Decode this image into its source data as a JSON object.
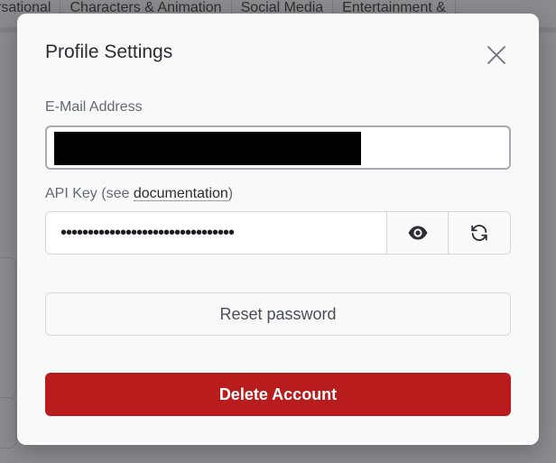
{
  "background": {
    "tabs": [
      "rsational",
      "Characters & Animation",
      "Social Media",
      "Entertainment &"
    ]
  },
  "modal": {
    "title": "Profile Settings",
    "close_icon": "close-icon",
    "email": {
      "label": "E-Mail Address",
      "value": "[redacted]"
    },
    "api_key": {
      "label_prefix": "API Key (see ",
      "link_text": "documentation",
      "label_suffix": ")",
      "value_masked": "••••••••••••••••••••••••••••••••",
      "show_icon": "eye-icon",
      "regenerate_icon": "refresh-icon"
    },
    "reset_password_label": "Reset password",
    "delete_account_label": "Delete Account"
  },
  "colors": {
    "danger": "#b91c1c",
    "modal_bg": "#f8f9f9",
    "text_primary": "#2b2d33",
    "text_muted": "#646a73"
  }
}
